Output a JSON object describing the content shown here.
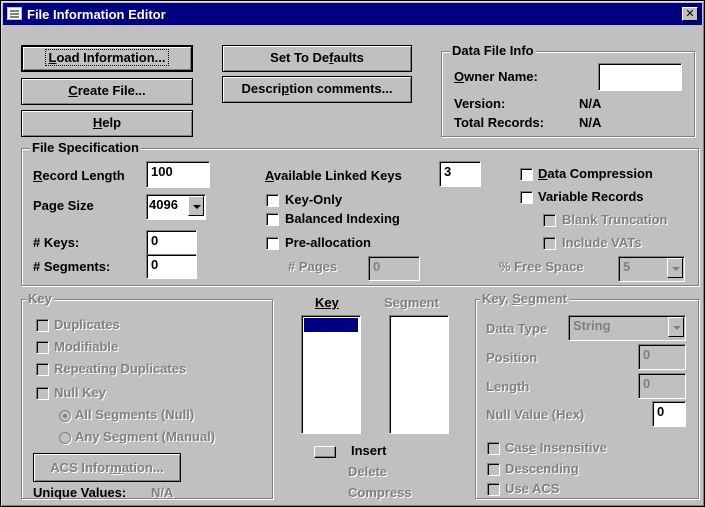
{
  "window": {
    "title": "File Information Editor",
    "close_glyph": "✕",
    "icon": "app-window-icon"
  },
  "buttons": {
    "load_information": {
      "pre": "",
      "u": "L",
      "post": "oad Information..."
    },
    "create_file": {
      "pre": "",
      "u": "C",
      "post": "reate File..."
    },
    "help": {
      "pre": "",
      "u": "H",
      "post": "elp"
    },
    "set_to_defaults": {
      "pre": "Set To De",
      "u": "f",
      "post": "aults"
    },
    "description_comments": {
      "pre": "Descri",
      "u": "p",
      "post": "tion comments..."
    },
    "acs_information": {
      "pre": "ACS Infor",
      "u": "m",
      "post": "ation..."
    }
  },
  "data_file_info": {
    "legend": "Data File Info",
    "owner_name_u": "O",
    "owner_name_post": "wner Name:",
    "owner_name_value": "",
    "version_label": "Version:",
    "version_value": "N/A",
    "total_records_label": "Total Records:",
    "total_records_value": "N/A"
  },
  "file_spec": {
    "legend": "File Specification",
    "record_length_u": "R",
    "record_length_post": "ecord Length",
    "record_length_value": "100",
    "page_size_label": "Page Size",
    "page_size_value": "4096",
    "keys_label": "# Keys:",
    "keys_value": "0",
    "segments_label": "# Segments:",
    "segments_value": "0",
    "available_linked_keys_u": "A",
    "available_linked_keys_post": "vailable Linked Keys",
    "available_linked_keys_value": "3",
    "key_only": "Key-Only",
    "balanced_indexing": "Balanced Indexing",
    "pre_allocation": "Pre-allocation",
    "pages_label": "# Pages",
    "pages_value": "0",
    "data_compression_u": "D",
    "data_compression_post": "ata Compression",
    "variable_records": "Variable Records",
    "blank_truncation": "Blank Truncation",
    "include_vats": "Include VATs",
    "free_space_label": "% Free Space",
    "free_space_value": "5"
  },
  "key_group": {
    "legend": "Key",
    "duplicates": "Duplicates",
    "modifiable": "Modifiable",
    "repeating_duplicates": "Repeating Duplicates",
    "null_key": "Null Key",
    "all_segments": "All Segments (Null)",
    "any_segment": "Any Segment (Manual)",
    "unique_values_label": "Unique Values:",
    "unique_values_value": "N/A"
  },
  "lists": {
    "key_header": "Key",
    "segment_header_pre": "Se",
    "segment_header_u": "g",
    "segment_header_post": "ment",
    "insert": "Insert",
    "delete": "Delete",
    "compress": "Compress"
  },
  "key_segment": {
    "legend_pre": "Key, ",
    "legend_u": "S",
    "legend_post": "egment",
    "data_type_label": "Data Type",
    "data_type_value": "String",
    "position_label": "Position",
    "position_value": "0",
    "length_label": "Length",
    "length_value": "0",
    "null_value_label": "Null Value (Hex)",
    "null_value_value": "0",
    "case_insensitive_pre": "Cas",
    "case_insensitive_u": "e",
    "case_insensitive_post": " Insensitive",
    "descending": "Descending",
    "use_acs": "Use ACS"
  }
}
